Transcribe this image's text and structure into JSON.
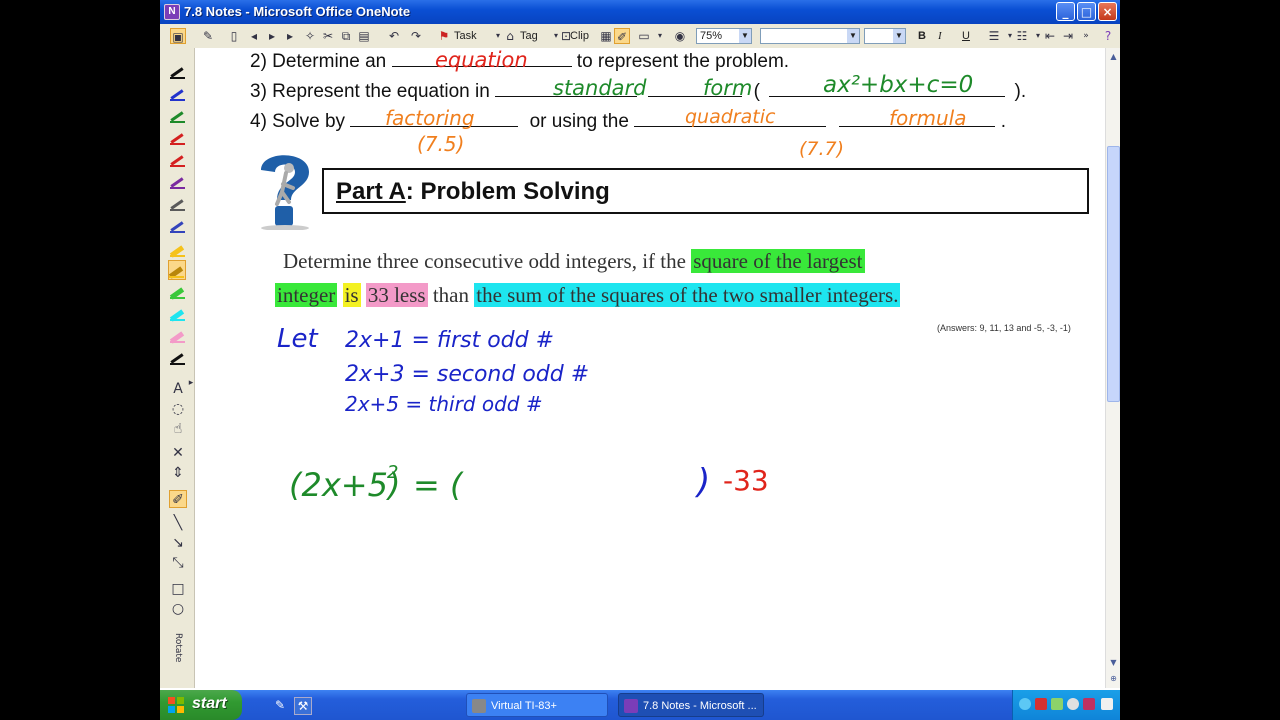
{
  "window": {
    "title": "7.8 Notes - Microsoft Office OneNote",
    "app_icon": "onenote-icon"
  },
  "toolbar": {
    "task_label": "Task",
    "tag_label": "Tag",
    "clip_label": "Clip",
    "zoom_value": "75%",
    "font_value": "",
    "size_value": "",
    "bold_label": "B",
    "italic_label": "I",
    "underline_label": "U"
  },
  "notes": {
    "line2_prefix": "2)  Determine an",
    "line2_suffix": "to represent the problem.",
    "line3_prefix": "3)  Represent the equation in",
    "line3_paren_open": "(",
    "line3_suffix": ").",
    "line4_prefix": "4)  Solve by",
    "line4_mid": "or using the",
    "line4_end": "."
  },
  "handwriting": {
    "equation": "equation",
    "standard": "standard",
    "form": "form",
    "general_form": "ax²+bx+c=0",
    "factoring": "factoring",
    "factoring_ref": "(7.5)",
    "quadratic": "quadratic",
    "quadratic_ref": "(7.7)",
    "formula": "formula",
    "let": "Let",
    "first": "2x+1 = first odd #",
    "second": "2x+3 = second odd #",
    "third": "2x+5 = third odd #",
    "eq_left": "(2x+5)",
    "eq_exp": "2",
    "eq_equals": "= (",
    "eq_close": ")",
    "eq_minus": "-33"
  },
  "part_a": {
    "part": "Part A",
    "rest": ": Problem Solving"
  },
  "problem": {
    "t1": "Determine three consecutive odd integers, if the ",
    "t2": "square of the largest",
    "t3": "integer",
    "t4": "is",
    "t5": "33 less",
    "t6": " than ",
    "t7": "the sum of the squares of the two smaller integers."
  },
  "answers": "(Answers: 9, 11, 13 and -5, -3, -1)",
  "pens": [
    "#111111",
    "#2233cc",
    "#1e8a2a",
    "#d42020",
    "#d42020",
    "#7a2aa0",
    "#5a5a5a",
    "#3344bb",
    "#f5c21a",
    "#f5c21a",
    "#3ac83a",
    "#1ee5ef",
    "#f39ac8",
    "#111111"
  ],
  "taskbar": {
    "start_label": "start",
    "task1": "Virtual TI-83+",
    "task2": "7.8 Notes - Microsoft ..."
  },
  "colors": {
    "titlebar": "#0a4fd4",
    "highlight_green": "#39e83a",
    "highlight_cyan": "#1ee5ef",
    "highlight_yellow": "#f3f122",
    "highlight_pink": "#f39ac8"
  }
}
